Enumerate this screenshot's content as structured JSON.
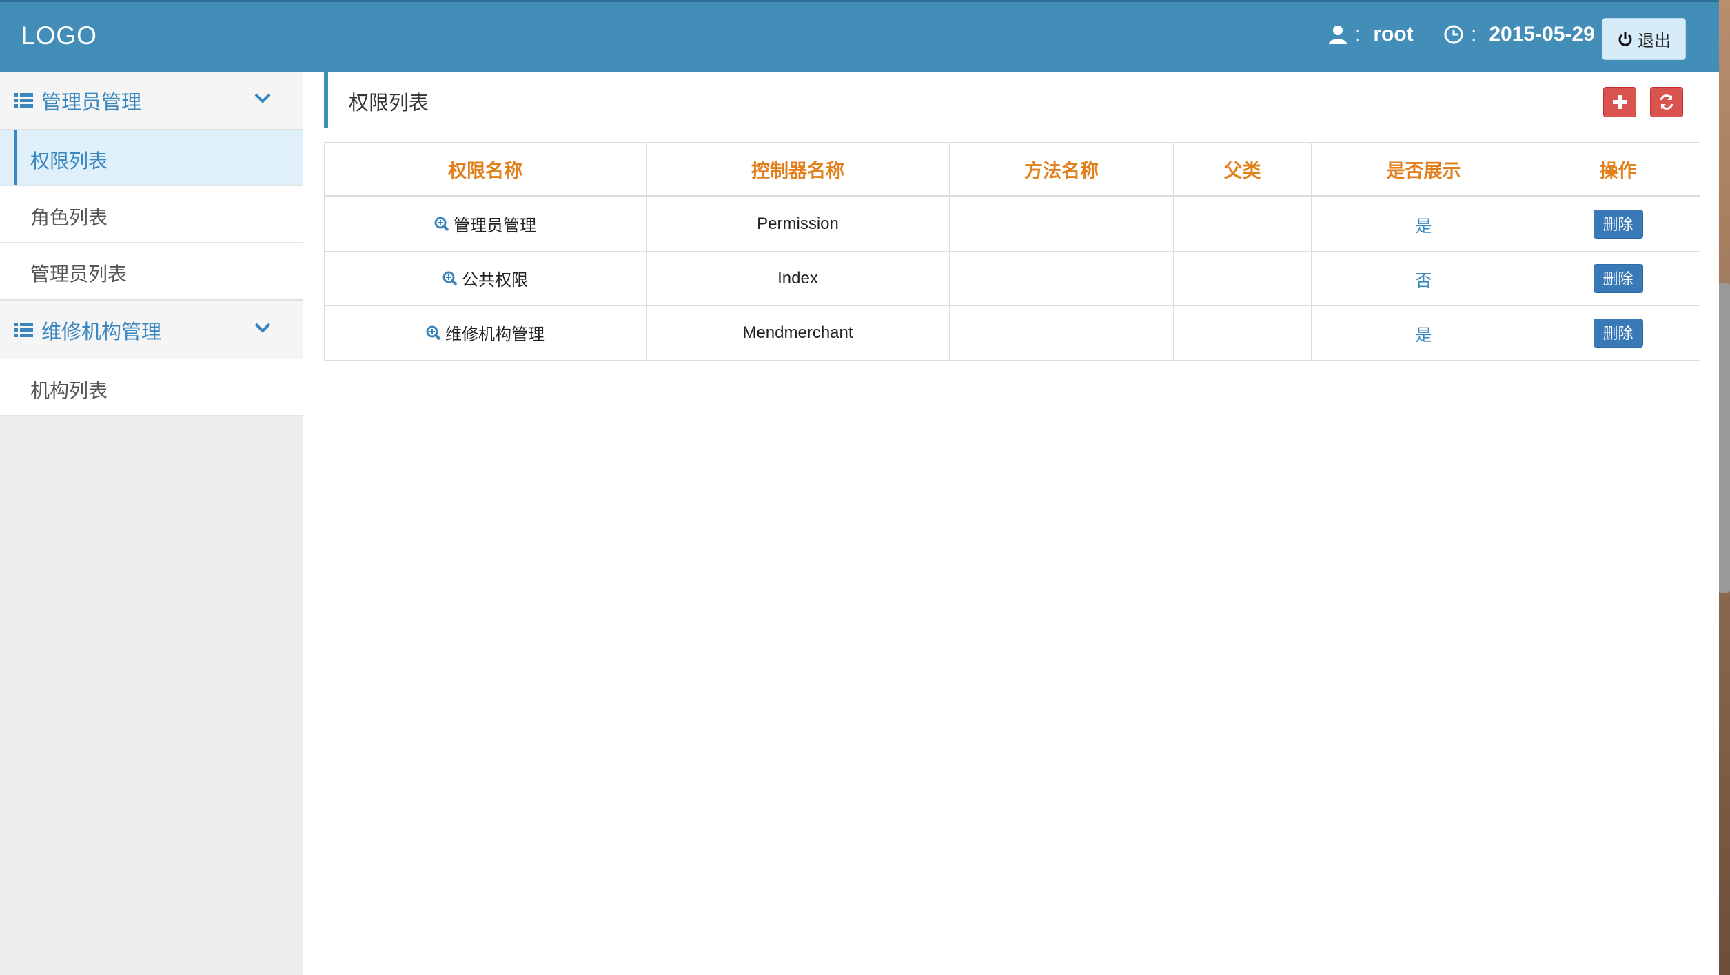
{
  "header": {
    "logo": "LOGO",
    "user_colon": ":",
    "username": "root",
    "date_colon": ":",
    "date": "2015-05-29",
    "logout_label": "退出",
    "colors": {
      "bar": "#438eb9"
    }
  },
  "sidebar": {
    "groups": [
      {
        "label": "管理员管理",
        "icon": "list-icon",
        "items": [
          {
            "label": "权限列表",
            "active": true
          },
          {
            "label": "角色列表"
          },
          {
            "label": "管理员列表"
          }
        ]
      },
      {
        "label": "维修机构管理",
        "icon": "list-icon",
        "items": [
          {
            "label": "机构列表"
          }
        ]
      }
    ]
  },
  "main": {
    "title": "权限列表",
    "add_icon": "plus-icon",
    "refresh_icon": "refresh-icon",
    "table": {
      "headers": [
        "权限名称",
        "控制器名称",
        "方法名称",
        "父类",
        "是否展示",
        "操作"
      ],
      "rows": [
        {
          "name": "管理员管理",
          "controller": "Permission",
          "method": "",
          "parent": "",
          "show": "是",
          "action": "删除"
        },
        {
          "name": "公共权限",
          "controller": "Index",
          "method": "",
          "parent": "",
          "show": "否",
          "action": "删除"
        },
        {
          "name": "维修机构管理",
          "controller": "Mendmerchant",
          "method": "",
          "parent": "",
          "show": "是",
          "action": "删除"
        }
      ]
    }
  }
}
